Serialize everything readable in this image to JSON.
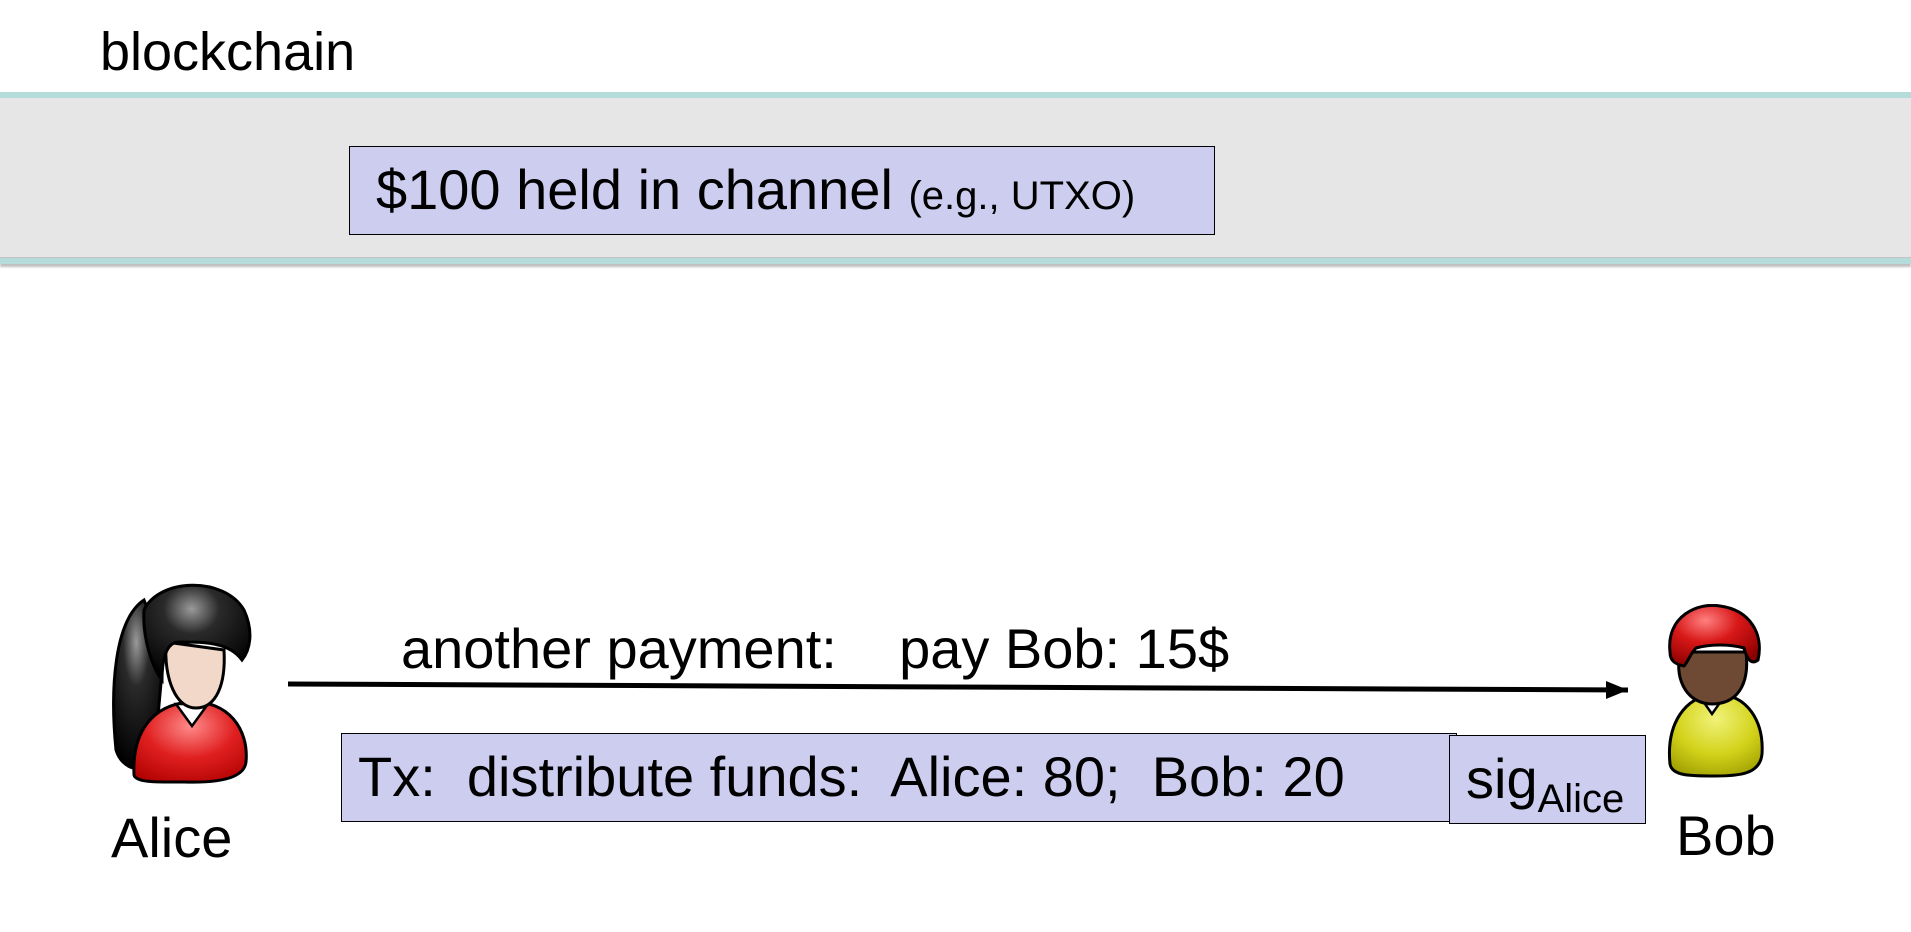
{
  "blockchain": {
    "title": "blockchain",
    "channel_main": "$100 held in channel ",
    "channel_note": "(e.g., UTXO)"
  },
  "message": {
    "label": "another payment:    pay Bob: 15$"
  },
  "transaction": {
    "text": "Tx:  distribute funds:  Alice: 80;  Bob: 20",
    "sig": "sig",
    "sig_subscript": "Alice"
  },
  "parties": {
    "alice": "Alice",
    "bob": "Bob"
  },
  "colors": {
    "box_fill": "#cdcdf0",
    "band_fill": "#e6e6e6",
    "band_edge": "#b6dbdb"
  },
  "icons": {
    "alice": "alice-person-icon",
    "bob": "bob-person-icon"
  }
}
